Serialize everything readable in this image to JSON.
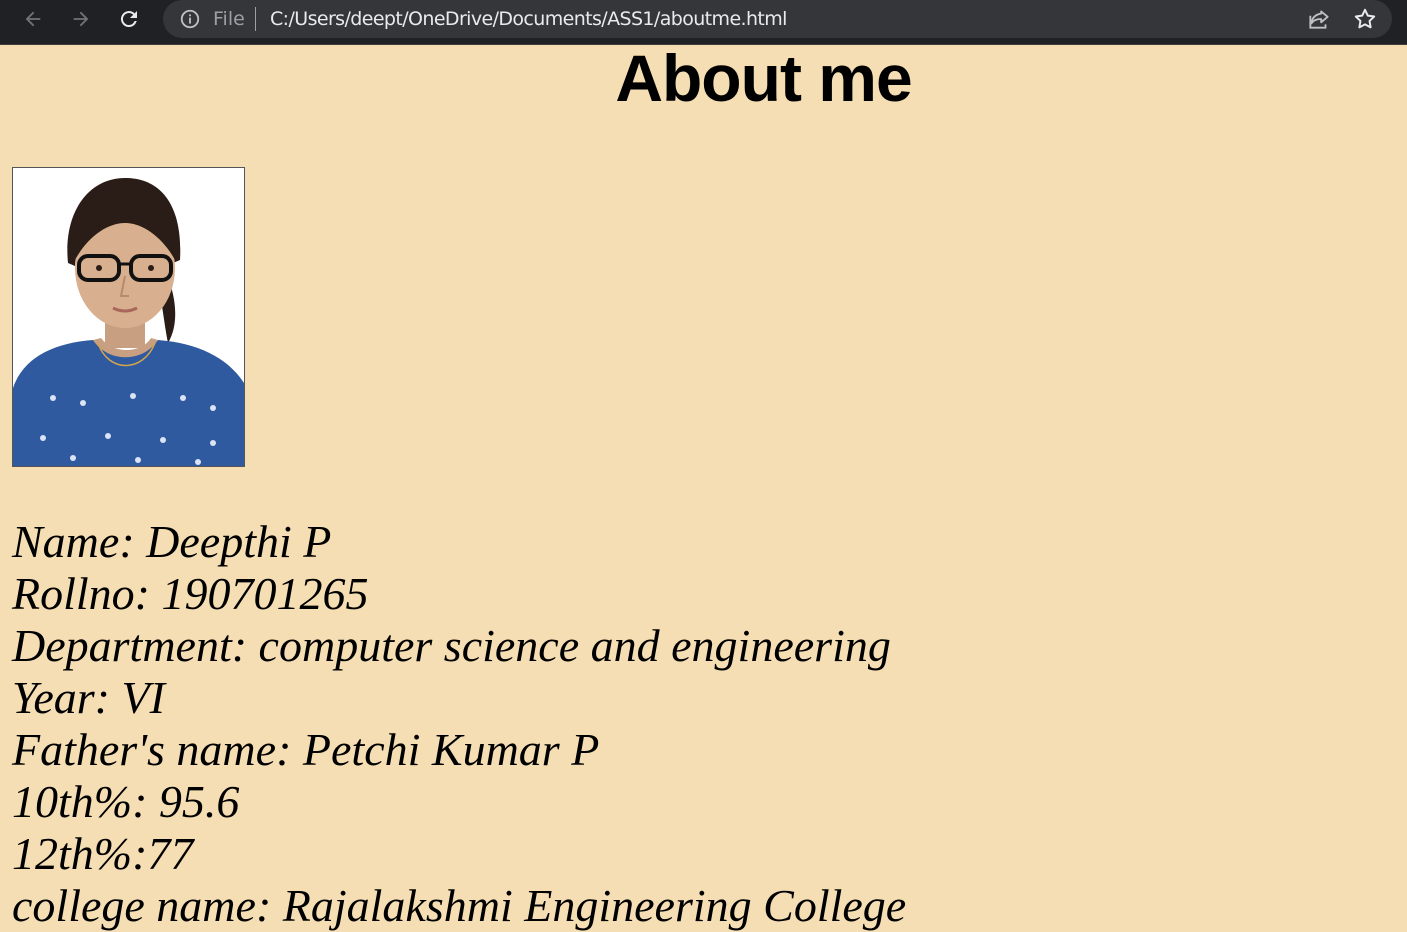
{
  "browser": {
    "scheme_label": "File",
    "url": "C:/Users/deept/OneDrive/Documents/ASS1/aboutme.html",
    "icons": [
      "back-icon",
      "forward-icon",
      "reload-icon",
      "info-icon",
      "share-icon",
      "star-icon"
    ]
  },
  "page": {
    "title": "About me",
    "background_color": "#f5deb3",
    "details": [
      "Name: Deepthi P",
      "Rollno: 190701265",
      "Department: computer science and engineering",
      "Year: VI",
      "Father's name: Petchi Kumar P",
      "10th%: 95.6",
      "12th%:77",
      "college name: Rajalakshmi Engineering College"
    ]
  }
}
